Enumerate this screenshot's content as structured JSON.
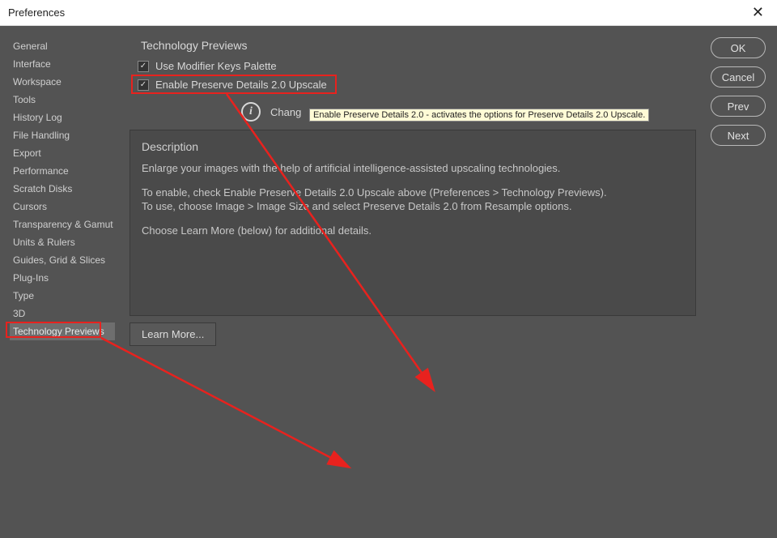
{
  "window": {
    "title": "Preferences"
  },
  "sidebar": {
    "items": [
      {
        "label": "General"
      },
      {
        "label": "Interface"
      },
      {
        "label": "Workspace"
      },
      {
        "label": "Tools"
      },
      {
        "label": "History Log"
      },
      {
        "label": "File Handling"
      },
      {
        "label": "Export"
      },
      {
        "label": "Performance"
      },
      {
        "label": "Scratch Disks"
      },
      {
        "label": "Cursors"
      },
      {
        "label": "Transparency & Gamut"
      },
      {
        "label": "Units & Rulers"
      },
      {
        "label": "Guides, Grid & Slices"
      },
      {
        "label": "Plug-Ins"
      },
      {
        "label": "Type"
      },
      {
        "label": "3D"
      },
      {
        "label": "Technology Previews"
      }
    ],
    "active_index": 16
  },
  "panel": {
    "title": "Technology Previews",
    "checkbox1": {
      "label": "Use Modifier Keys Palette",
      "checked": true
    },
    "checkbox2": {
      "label": "Enable Preserve Details 2.0 Upscale",
      "checked": true
    },
    "info_partial_text": "Chang",
    "tooltip": "Enable Preserve Details 2.0  - activates the options for Preserve Details 2.0 Upscale.",
    "description": {
      "heading": "Description",
      "p1": "Enlarge your images with the help of artificial intelligence-assisted upscaling technologies.",
      "p2": "To enable, check Enable Preserve Details 2.0 Upscale above (Preferences > Technology Previews).",
      "p3": "To use, choose Image > Image Size and select Preserve Details 2.0 from Resample options.",
      "p4": "Choose Learn More (below) for additional details."
    },
    "learn_more": "Learn More..."
  },
  "buttons": {
    "ok": "OK",
    "cancel": "Cancel",
    "prev": "Prev",
    "next": "Next"
  },
  "annotations": {
    "highlight_color": "#e8221e"
  }
}
